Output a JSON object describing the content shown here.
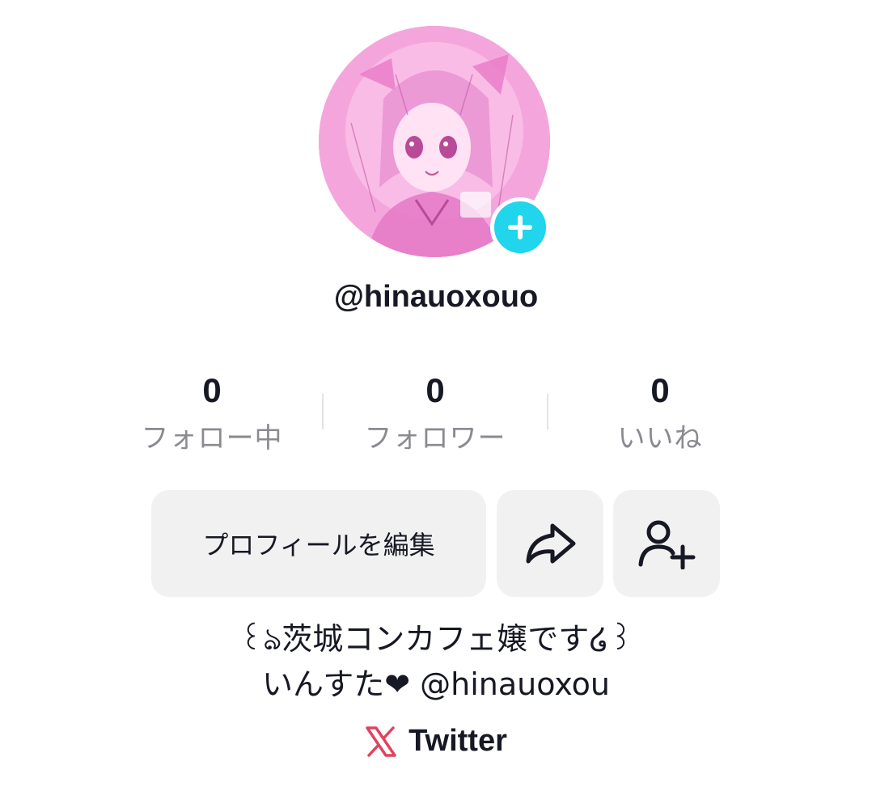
{
  "profile": {
    "username": "@hinauoxouo"
  },
  "stats": [
    {
      "value": "0",
      "label": "フォロー中"
    },
    {
      "value": "0",
      "label": "フォロワー"
    },
    {
      "value": "0",
      "label": "いいね"
    }
  ],
  "actions": {
    "edit_label": "プロフィールを編集",
    "share_icon": "share-arrow-icon",
    "add_friend_icon": "add-friend-icon"
  },
  "bio": {
    "line1": "꒰ঌ茨城コンカフェ嬢です໒꒱",
    "line2": "いんすた❤︎ @hinauoxou"
  },
  "link": {
    "label": "Twitter",
    "icon": "x-logo-icon"
  },
  "colors": {
    "accent": "#20d5ec",
    "link_icon": "#e0435d",
    "button_bg": "#f1f1f2",
    "muted_text": "#8a8b91"
  }
}
